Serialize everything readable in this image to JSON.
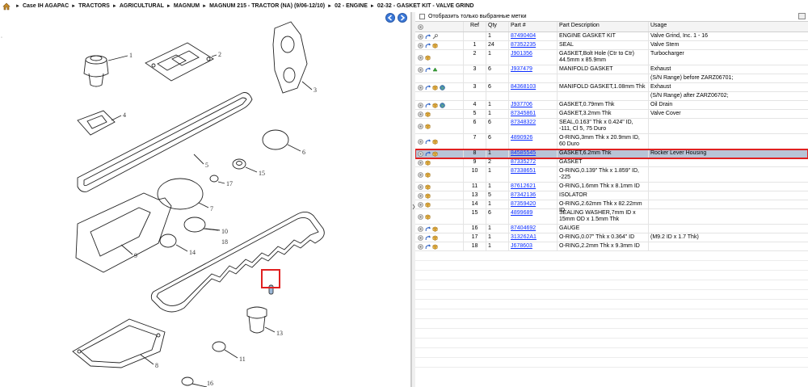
{
  "breadcrumb": {
    "items": [
      "Case IH AGAPAC",
      "TRACTORS",
      "AGRICULTURAL",
      "MAGNUM",
      "MAGNUM 215 - TRACTOR (NA) (9/06-12/10)",
      "02 - ENGINE",
      "02-32 - GASKET KIT - VALVE GRIND"
    ],
    "separator": "►"
  },
  "filter": {
    "label": "Отобразить только выбранные метки",
    "checked": false
  },
  "table": {
    "headers": {
      "ref": "Ref",
      "qty": "Qty",
      "part": "Part #",
      "desc": "Part Description",
      "usage": "Usage"
    },
    "rows": [
      {
        "icons": [
          "gear-icon",
          "arrow-icon",
          "wrench-icon"
        ],
        "ref": "",
        "qty": "1",
        "part": "87490404",
        "desc": "ENGINE GASKET KIT",
        "usage": "Valve Grind, Inc. 1 - 16"
      },
      {
        "icons": [
          "gear-icon",
          "arrow-icon",
          "box-icon"
        ],
        "ref": "1",
        "qty": "24",
        "part": "87352235",
        "desc": "SEAL",
        "usage": "Valve Stem"
      },
      {
        "icons": [
          "gear-icon",
          "box-icon"
        ],
        "ref": "2",
        "qty": "1",
        "part": "J901356",
        "desc": "GASKET,Bolt Hole (Ctr to Ctr) 44.5mm x 85.9mm",
        "usage": "Turbocharger"
      },
      {
        "icons": [
          "gear-icon",
          "arrow-icon",
          "recycle-icon"
        ],
        "ref": "3",
        "qty": "6",
        "part": "J937479",
        "desc": "MANIFOLD GASKET",
        "usage": "Exhaust"
      },
      {
        "icons": [],
        "ref": "",
        "qty": "",
        "part": "",
        "desc": "",
        "usage": "(S/N Range) before ZARZ06701;"
      },
      {
        "icons": [
          "gear-icon",
          "arrow-icon",
          "box-icon",
          "globe-icon"
        ],
        "ref": "3",
        "qty": "6",
        "part": "84368103",
        "desc": "MANIFOLD GASKET,1.08mm Thk",
        "usage": "Exhaust"
      },
      {
        "icons": [],
        "ref": "",
        "qty": "",
        "part": "",
        "desc": "",
        "usage": "(S/N Range) after ZARZ06702;"
      },
      {
        "icons": [
          "gear-icon",
          "arrow-icon",
          "box-icon",
          "globe-icon"
        ],
        "ref": "4",
        "qty": "1",
        "part": "J937706",
        "desc": "GASKET,0.79mm Thk",
        "usage": "Oil Drain"
      },
      {
        "icons": [
          "gear-icon",
          "box-icon"
        ],
        "ref": "5",
        "qty": "1",
        "part": "87345861",
        "desc": "GASKET,3.2mm Thk",
        "usage": "Valve Cover"
      },
      {
        "icons": [
          "gear-icon",
          "box-icon"
        ],
        "ref": "6",
        "qty": "6",
        "part": "87348322",
        "desc": "SEAL,0.163\" Thk x 0.424\" ID, -111, Cl 5, 75 Duro",
        "usage": ""
      },
      {
        "icons": [
          "gear-icon",
          "arrow-icon",
          "box-icon"
        ],
        "ref": "7",
        "qty": "6",
        "part": "4890926",
        "desc": "O-RING,3mm Thk x 20.9mm ID, 60 Duro",
        "usage": ""
      },
      {
        "icons": [
          "gear-icon",
          "arrow-icon",
          "box-icon"
        ],
        "ref": "8",
        "qty": "1",
        "part": "84585545",
        "desc": "GASKET,6.2mm Thk",
        "usage": "Rocker Lever Housing",
        "selected": true
      },
      {
        "icons": [
          "gear-icon",
          "box-icon"
        ],
        "ref": "9",
        "qty": "2",
        "part": "87335272",
        "desc": "GASKET",
        "usage": ""
      },
      {
        "icons": [
          "gear-icon",
          "box-icon"
        ],
        "ref": "10",
        "qty": "1",
        "part": "87338651",
        "desc": "O-RING,0.139\" Thk x 1.859\" ID, -225",
        "usage": ""
      },
      {
        "icons": [
          "gear-icon",
          "box-icon"
        ],
        "ref": "11",
        "qty": "1",
        "part": "87612621",
        "desc": "O-RING,1.6mm Thk x 8.1mm ID",
        "usage": ""
      },
      {
        "icons": [
          "gear-icon",
          "box-icon"
        ],
        "ref": "13",
        "qty": "5",
        "part": "87342136",
        "desc": "ISOLATOR",
        "usage": ""
      },
      {
        "icons": [
          "gear-icon",
          "box-icon"
        ],
        "ref": "14",
        "qty": "1",
        "part": "87359420",
        "desc": "O-RING,2.62mm Thk x 82.22mm ID",
        "usage": ""
      },
      {
        "icons": [
          "gear-icon",
          "box-icon"
        ],
        "ref": "15",
        "qty": "6",
        "part": "4899689",
        "desc": "SEALING WASHER,7mm ID x 15mm OD x 1.5mm Thk",
        "usage": ""
      },
      {
        "icons": [
          "gear-icon",
          "arrow-icon",
          "box-icon"
        ],
        "ref": "16",
        "qty": "1",
        "part": "87404692",
        "desc": "GAUGE",
        "usage": ""
      },
      {
        "icons": [
          "gear-icon",
          "arrow-icon",
          "box-icon"
        ],
        "ref": "17",
        "qty": "1",
        "part": "313262A1",
        "desc": "O-RING,0.07\" Thk x 0.364\" ID",
        "usage": "(M9.2 ID x 1.7 Thk)"
      },
      {
        "icons": [
          "gear-icon",
          "arrow-icon",
          "box-icon"
        ],
        "ref": "18",
        "qty": "1",
        "part": "J678603",
        "desc": "O-RING,2.2mm Thk x 9.3mm ID",
        "usage": ""
      }
    ]
  },
  "diagram": {
    "callouts": [
      "1",
      "2",
      "3",
      "4",
      "5",
      "6",
      "7",
      "8",
      "9",
      "10",
      "11",
      "13",
      "14",
      "15",
      "16",
      "17",
      "18"
    ]
  },
  "colors": {
    "link": "#0b2dff",
    "selection": "#b8c4d6",
    "highlight": "#e02020",
    "navButton": "#3b78d8"
  }
}
